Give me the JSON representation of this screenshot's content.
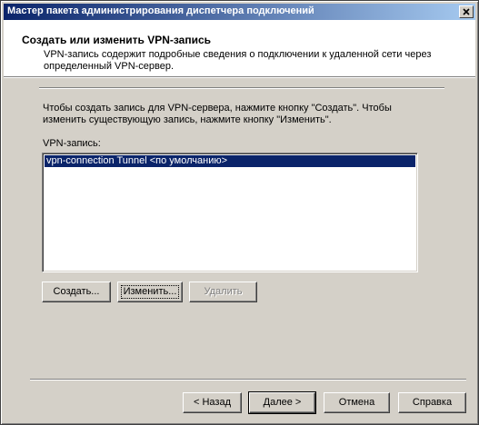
{
  "window": {
    "title": "Мастер пакета администрирования диспетчера подключений",
    "close_label": "✕"
  },
  "header": {
    "title": "Создать или изменить VPN-запись",
    "description": "VPN-запись содержит подробные сведения о подключении к удаленной сети через определенный VPN-сервер."
  },
  "body": {
    "intro": "Чтобы создать запись для VPN-сервера, нажмите кнопку \"Создать\". Чтобы изменить существующую запись, нажмите кнопку \"Изменить\".",
    "list_label": "VPN-запись:",
    "list_items": [
      {
        "label": "vpn-connection Tunnel <по умолчанию>",
        "selected": true
      }
    ]
  },
  "buttons": {
    "create": "Создать...",
    "edit": "Изменить...",
    "delete": "Удалить",
    "back": "< Назад",
    "next": "Далее >",
    "cancel": "Отмена",
    "help": "Справка"
  },
  "icons": {
    "close": "close-icon"
  },
  "colors": {
    "title_bar": "#0a246a",
    "selection": "#0a246a",
    "dialog_face": "#d4d0c8"
  }
}
